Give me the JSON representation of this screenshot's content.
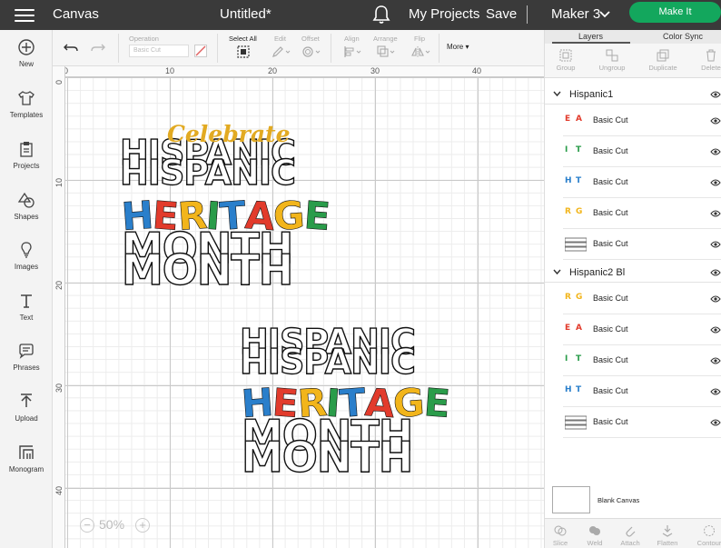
{
  "topbar": {
    "app_title": "Canvas",
    "doc_title": "Untitled*",
    "my_projects": "My Projects",
    "save": "Save",
    "machine": "Maker 3",
    "make_it": "Make It"
  },
  "sidebar": {
    "items": [
      {
        "label": "New",
        "icon": "plus-circle-icon"
      },
      {
        "label": "Templates",
        "icon": "tshirt-icon"
      },
      {
        "label": "Projects",
        "icon": "clipboard-icon"
      },
      {
        "label": "Shapes",
        "icon": "shapes-icon"
      },
      {
        "label": "Images",
        "icon": "lightbulb-icon"
      },
      {
        "label": "Text",
        "icon": "text-t-icon"
      },
      {
        "label": "Phrases",
        "icon": "speech-bubble-icon"
      },
      {
        "label": "Upload",
        "icon": "upload-icon"
      },
      {
        "label": "Monogram",
        "icon": "monogram-icon"
      }
    ]
  },
  "toolbar": {
    "operation_label": "Operation",
    "operation_value": "Basic Cut",
    "select_all": "Select All",
    "edit": "Edit",
    "offset": "Offset",
    "align": "Align",
    "arrange": "Arrange",
    "flip": "Flip",
    "more": "More"
  },
  "ruler": {
    "top": [
      "0",
      "10",
      "20",
      "30",
      "40"
    ],
    "left": [
      "0",
      "10",
      "20",
      "30",
      "40"
    ]
  },
  "design1": {
    "celebrate": "Celebrate",
    "hispanic": "HISPANIC",
    "heritage_letters": [
      "H",
      "E",
      "R",
      "I",
      "T",
      "A",
      "G",
      "E"
    ],
    "heritage_colors": [
      "#2a7fcb",
      "#e23b2c",
      "#f2b51b",
      "#2a9c4a",
      "#2a7fcb",
      "#e23b2c",
      "#f2b51b",
      "#2a9c4a"
    ],
    "month": "MONTH"
  },
  "design2": {
    "hispanic": "HISPANIC",
    "heritage_letters": [
      "H",
      "E",
      "R",
      "I",
      "T",
      "A",
      "G",
      "E"
    ],
    "heritage_colors": [
      "#2a7fcb",
      "#e23b2c",
      "#f2b51b",
      "#2a9c4a",
      "#2a7fcb",
      "#e23b2c",
      "#f2b51b",
      "#2a9c4a"
    ],
    "month": "MONTH"
  },
  "zoom": {
    "value": "50%",
    "minus": "−",
    "plus": "+"
  },
  "panel": {
    "tab_layers": "Layers",
    "tab_color_sync": "Color Sync",
    "tools": [
      "Group",
      "Ungroup",
      "Duplicate",
      "Delete"
    ],
    "groups": [
      {
        "name": "Hispanic1",
        "layers": [
          {
            "label": "Basic Cut",
            "thumb": [
              "E",
              "A"
            ],
            "colors": [
              "#e23b2c",
              "#e23b2c"
            ]
          },
          {
            "label": "Basic Cut",
            "thumb": [
              "I",
              "T"
            ],
            "colors": [
              "#2a9c4a",
              "#2a9c4a"
            ]
          },
          {
            "label": "Basic Cut",
            "thumb": [
              "H",
              "T"
            ],
            "colors": [
              "#2a7fcb",
              "#2a7fcb"
            ]
          },
          {
            "label": "Basic Cut",
            "thumb": [
              "R",
              "G"
            ],
            "colors": [
              "#f2b51b",
              "#f2b51b"
            ]
          },
          {
            "label": "Basic Cut",
            "thumb": [
              "",
              ""
            ],
            "colors": [
              "#222",
              "#222"
            ]
          }
        ]
      },
      {
        "name": "Hispanic2 Bl",
        "layers": [
          {
            "label": "Basic Cut",
            "thumb": [
              "R",
              "G"
            ],
            "colors": [
              "#f2b51b",
              "#f2b51b"
            ]
          },
          {
            "label": "Basic Cut",
            "thumb": [
              "E",
              "A"
            ],
            "colors": [
              "#e23b2c",
              "#e23b2c"
            ]
          },
          {
            "label": "Basic Cut",
            "thumb": [
              "I",
              "T"
            ],
            "colors": [
              "#2a9c4a",
              "#2a9c4a"
            ]
          },
          {
            "label": "Basic Cut",
            "thumb": [
              "H",
              "T"
            ],
            "colors": [
              "#2a7fcb",
              "#2a7fcb"
            ]
          },
          {
            "label": "Basic Cut",
            "thumb": [
              "",
              ""
            ],
            "colors": [
              "#222",
              "#222"
            ]
          }
        ]
      }
    ],
    "blank_canvas": "Blank Canvas",
    "bottom_tools": [
      "Slice",
      "Weld",
      "Attach",
      "Flatten",
      "Contour"
    ]
  }
}
